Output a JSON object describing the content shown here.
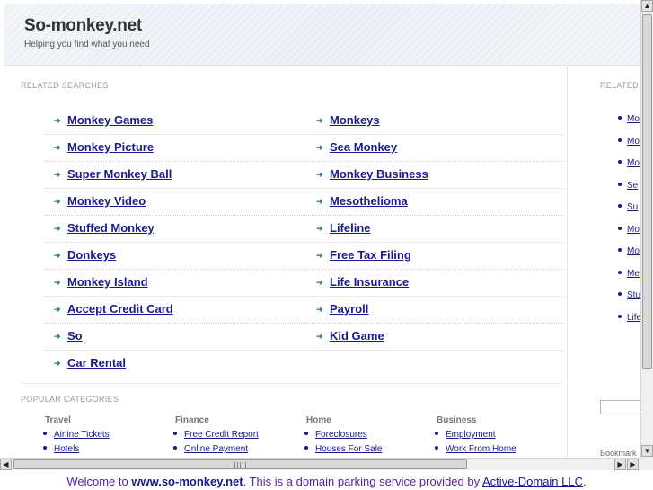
{
  "header": {
    "title": "So-monkey.net",
    "tagline": "Helping you find what you need"
  },
  "related": {
    "title": "RELATED SEARCHES",
    "rows": [
      [
        "Monkey Games",
        "Monkeys"
      ],
      [
        "Monkey Picture",
        "Sea Monkey"
      ],
      [
        "Super Monkey Ball",
        "Monkey Business"
      ],
      [
        "Monkey Video",
        "Mesothelioma"
      ],
      [
        "Stuffed Monkey",
        "Lifeline"
      ],
      [
        "Donkeys",
        "Free Tax Filing"
      ],
      [
        "Monkey Island",
        "Life Insurance"
      ],
      [
        "Accept Credit Card",
        "Payroll"
      ],
      [
        "So",
        "Kid Game"
      ],
      [
        "Car Rental",
        ""
      ]
    ]
  },
  "popular": {
    "title": "POPULAR CATEGORIES",
    "columns": [
      {
        "head": "Travel",
        "items": [
          "Airline Tickets",
          "Hotels"
        ]
      },
      {
        "head": "Finance",
        "items": [
          "Free Credit Report",
          "Online Payment"
        ]
      },
      {
        "head": "Home",
        "items": [
          "Foreclosures",
          "Houses For Sale"
        ]
      },
      {
        "head": "Business",
        "items": [
          "Employment",
          "Work From Home"
        ]
      }
    ]
  },
  "right_panel": {
    "title": "RELATED",
    "items": [
      "Mo",
      "Mo",
      "Mo",
      "Se",
      "Su",
      "Mo",
      "Mo",
      "Me",
      "Stu",
      "Life"
    ],
    "bookmark": "Bookmark"
  },
  "footer": {
    "prefix": "Welcome to ",
    "site": "www.so-monkey.net",
    "middle": ". This is a domain parking service provided by ",
    "provider": "Active-Domain LLC",
    "suffix": "."
  },
  "scrollbar": {
    "up": "▲",
    "down": "▼",
    "left": "◀",
    "right": "▶"
  },
  "colors": {
    "link": "#1a1a8c",
    "arrow": "#2e8a8a",
    "footer_text": "#5a1fa0"
  }
}
